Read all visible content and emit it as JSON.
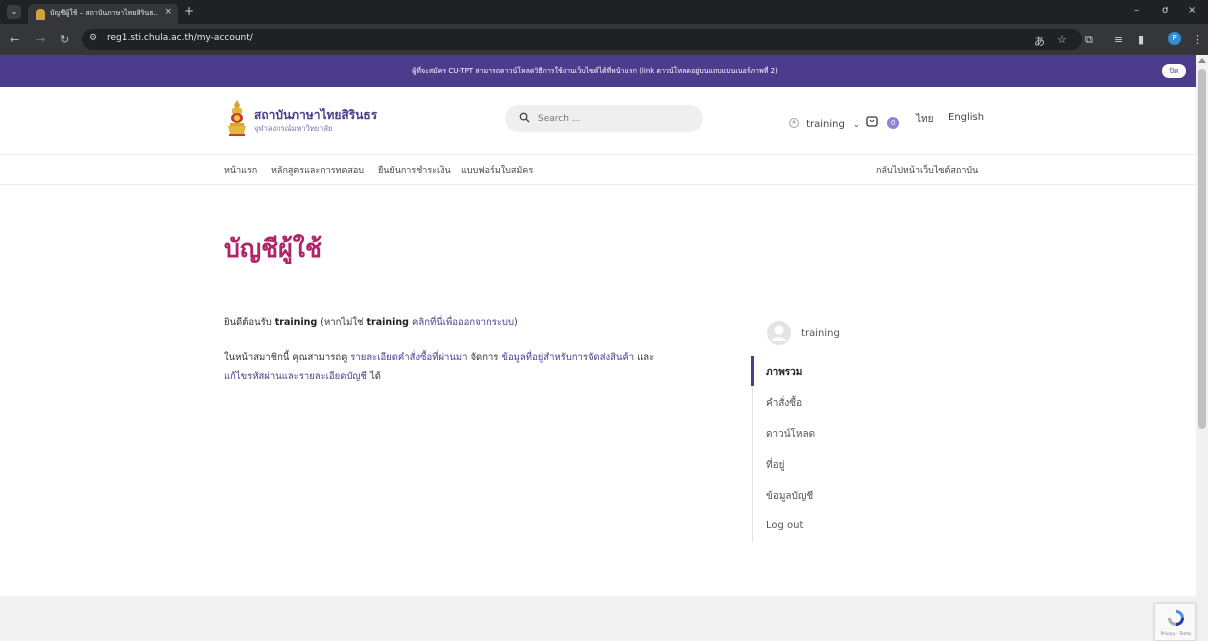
{
  "browser": {
    "tab_title": "บัญชีผู้ใช้ – สถาบันภาษาไทยสิรินธ...",
    "tab_close": "×",
    "new_tab": "+",
    "url": "reg1.sti.chula.ac.th/my-account/",
    "window_minimize": "–",
    "window_restore": "ơ",
    "window_close": "×",
    "profile_initial": "P"
  },
  "notice": {
    "text": "ผู้ที่จะสมัคร CU-TPT สามารถดาวน์โหลดวิธีการใช้งานเว็บไซต์ได้ที่หน้าแรก (link ดาวน์โหลดอยู่บนแถบแบนเนอร์ภาพที่ 2)",
    "close_label": "ปิด"
  },
  "header": {
    "logo_title": "สถาบันภาษาไทยสิรินธร",
    "logo_subtitle": "จุฬาลงกรณ์มหาวิทยาลัย",
    "search_placeholder": "Search ...",
    "user_name": "training",
    "cart_count": "0",
    "lang_th": "ไทย",
    "lang_en": "English"
  },
  "nav": {
    "items": [
      "หน้าแรก",
      "หลักสูตรและการทดสอบ",
      "ยืนยันการชำระเงิน",
      "แบบฟอร์มใบสมัคร"
    ],
    "back_link": "กลับไปหน้าเว็บไซต์สถาบัน"
  },
  "page": {
    "title": "บัญชีผู้ใช้",
    "welcome_prefix": "ยินดีต้อนรับ",
    "welcome_user": "training",
    "welcome_paren_open": "(หากไม่ใช่",
    "welcome_paren_user": "training",
    "logout_link": "คลิกที่นี่เพื่อออกจากระบบ",
    "welcome_paren_close": ")",
    "intro_prefix": "ในหน้าสมาชิกนี้ คุณสามารถดู",
    "intro_link_orders": "รายละเอียดคำสั่งซื้อที่ผ่านมา",
    "intro_mid": "จัดการ",
    "intro_link_address": "ข้อมูลที่อยู่สำหรับการจัดส่งสินค้า",
    "intro_and": "และ",
    "intro_link_account": "แก้ไขรหัสผ่านและรายละเอียดบัญชี",
    "intro_suffix": "ได้"
  },
  "account_nav": {
    "user_name": "training",
    "items": [
      "ภาพรวม",
      "คำสั่งซื้อ",
      "ดาวน์โหลด",
      "ที่อยู่",
      "ข้อมูลบัญชี",
      "Log out"
    ]
  },
  "recaptcha": {
    "text": "Privacy - Terms"
  },
  "colors": {
    "brand_purple": "#4b3c8c",
    "title_magenta": "#b02468"
  }
}
